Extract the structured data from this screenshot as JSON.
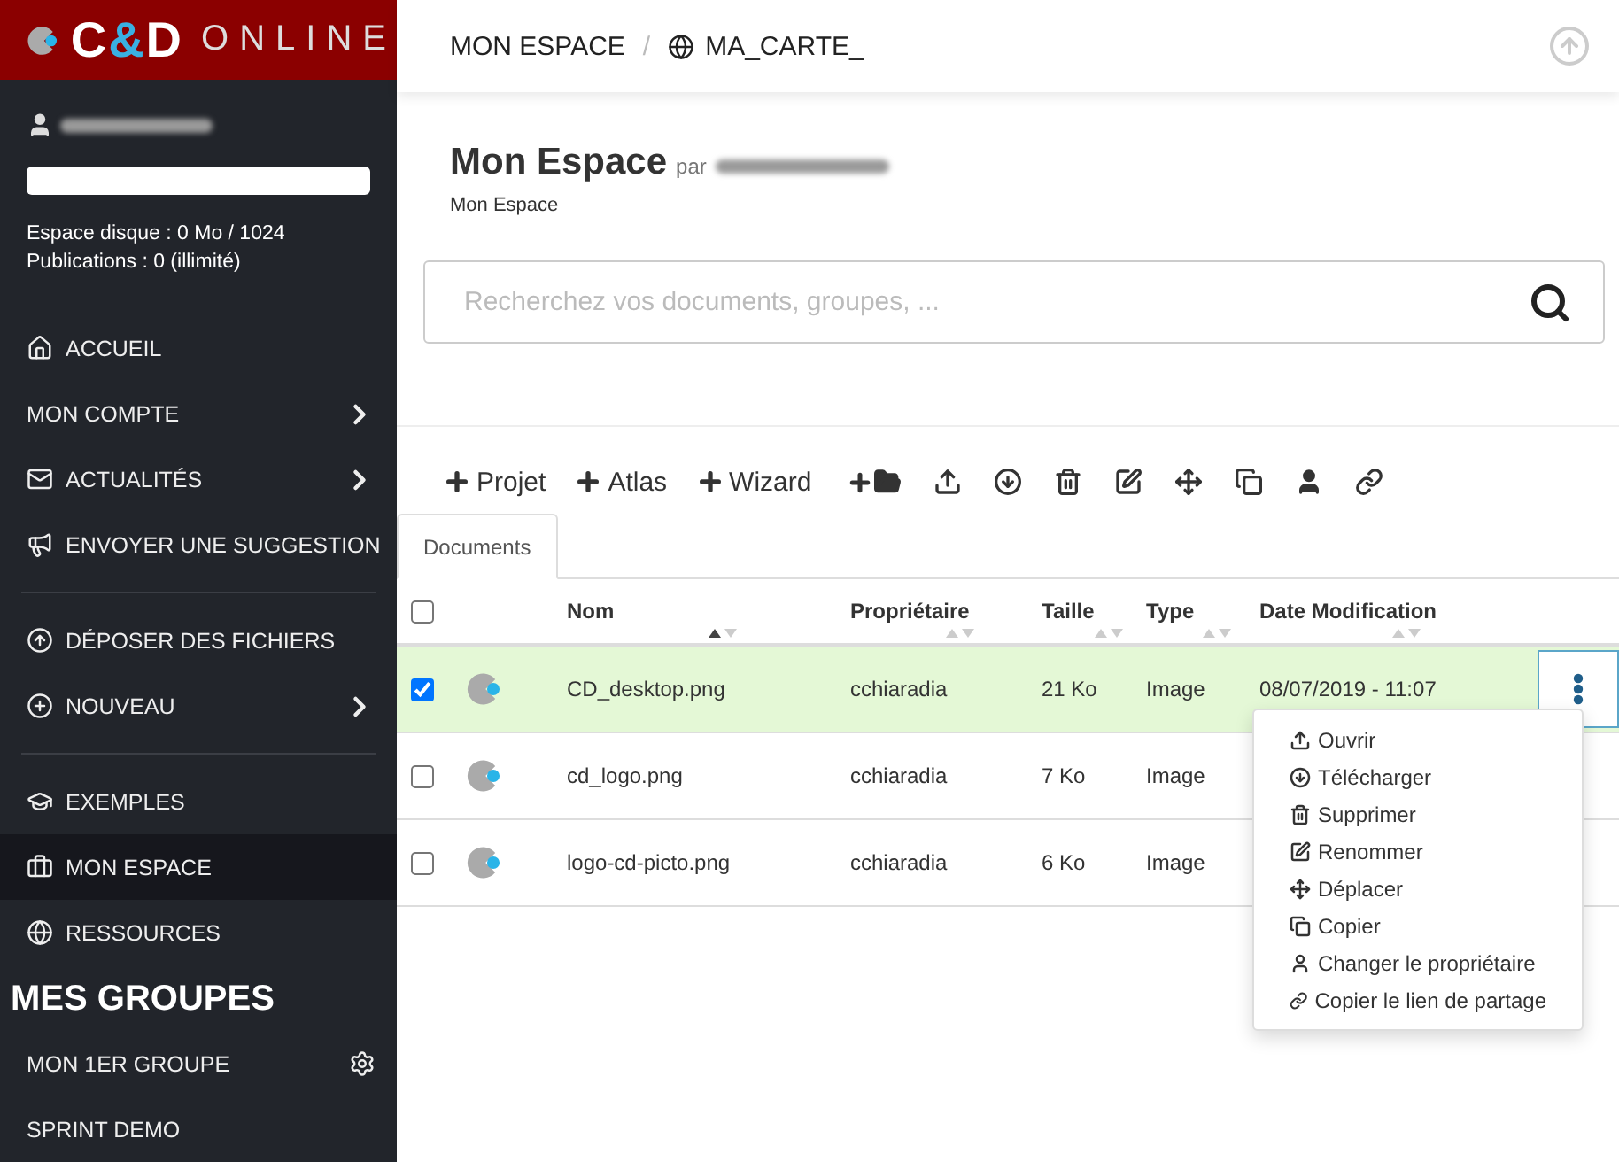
{
  "brand": {
    "name": "C&D",
    "suffix": "ONLINE"
  },
  "sidebar": {
    "disk": "Espace disque : 0 Mo / 1024",
    "publications": "Publications : 0 (illimité)",
    "groups": [
      [
        {
          "label": "ACCUEIL",
          "submenu": false,
          "selected": false
        },
        {
          "label": "MON COMPTE",
          "submenu": true,
          "selected": false
        },
        {
          "label": "ACTUALITÉS",
          "submenu": true,
          "selected": false
        },
        {
          "label": "ENVOYER UNE SUGGESTION",
          "submenu": false,
          "selected": false
        }
      ],
      [
        {
          "label": "DÉPOSER DES FICHIERS",
          "submenu": false,
          "selected": false
        },
        {
          "label": "NOUVEAU",
          "submenu": true,
          "selected": false
        }
      ],
      [
        {
          "label": "EXEMPLES",
          "submenu": false,
          "selected": false
        },
        {
          "label": "MON ESPACE",
          "submenu": false,
          "selected": true
        },
        {
          "label": "RESSOURCES",
          "submenu": false,
          "selected": false
        }
      ]
    ],
    "section": {
      "title": "MES GROUPES",
      "items": [
        {
          "label": "MON 1ER GROUPE",
          "settings": true
        },
        {
          "label": "SPRINT DEMO",
          "settings": false
        }
      ]
    }
  },
  "breadcrumb": {
    "items": [
      "MON ESPACE",
      "MA_CARTE_"
    ],
    "separator": "/"
  },
  "page": {
    "title": "Mon Espace",
    "by": "par",
    "subtitle": "Mon Espace"
  },
  "search": {
    "placeholder": "Recherchez vos documents, groupes, ..."
  },
  "toolbar": {
    "add_buttons": [
      "Projet",
      "Atlas",
      "Wizard"
    ]
  },
  "tabs": [
    {
      "label": "Documents",
      "selected": true
    }
  ],
  "table": {
    "select_all_checked": false,
    "columns": [
      {
        "label": "Nom",
        "sorted": true
      },
      {
        "label": "Propriétaire",
        "sorted": false
      },
      {
        "label": "Taille",
        "sorted": false
      },
      {
        "label": "Type",
        "sorted": false
      },
      {
        "label": "Date Modification",
        "sorted": false
      }
    ],
    "rows": [
      {
        "checked": true,
        "selected": true,
        "name": "CD_desktop.png",
        "owner": "cchiaradia",
        "size": "21 Ko",
        "type": "Image",
        "date": "08/07/2019 - 11:07",
        "menu_open": true
      },
      {
        "checked": false,
        "selected": false,
        "name": "cd_logo.png",
        "owner": "cchiaradia",
        "size": "7 Ko",
        "type": "Image",
        "menu_open": false
      },
      {
        "checked": false,
        "selected": false,
        "name": "logo-cd-picto.png",
        "owner": "cchiaradia",
        "size": "6 Ko",
        "type": "Image",
        "menu_open": false
      }
    ]
  },
  "context_menu": [
    "Ouvrir",
    "Télécharger",
    "Supprimer",
    "Renommer",
    "Déplacer",
    "Copier",
    "Changer le propriétaire",
    "Copier le lien de partage"
  ]
}
